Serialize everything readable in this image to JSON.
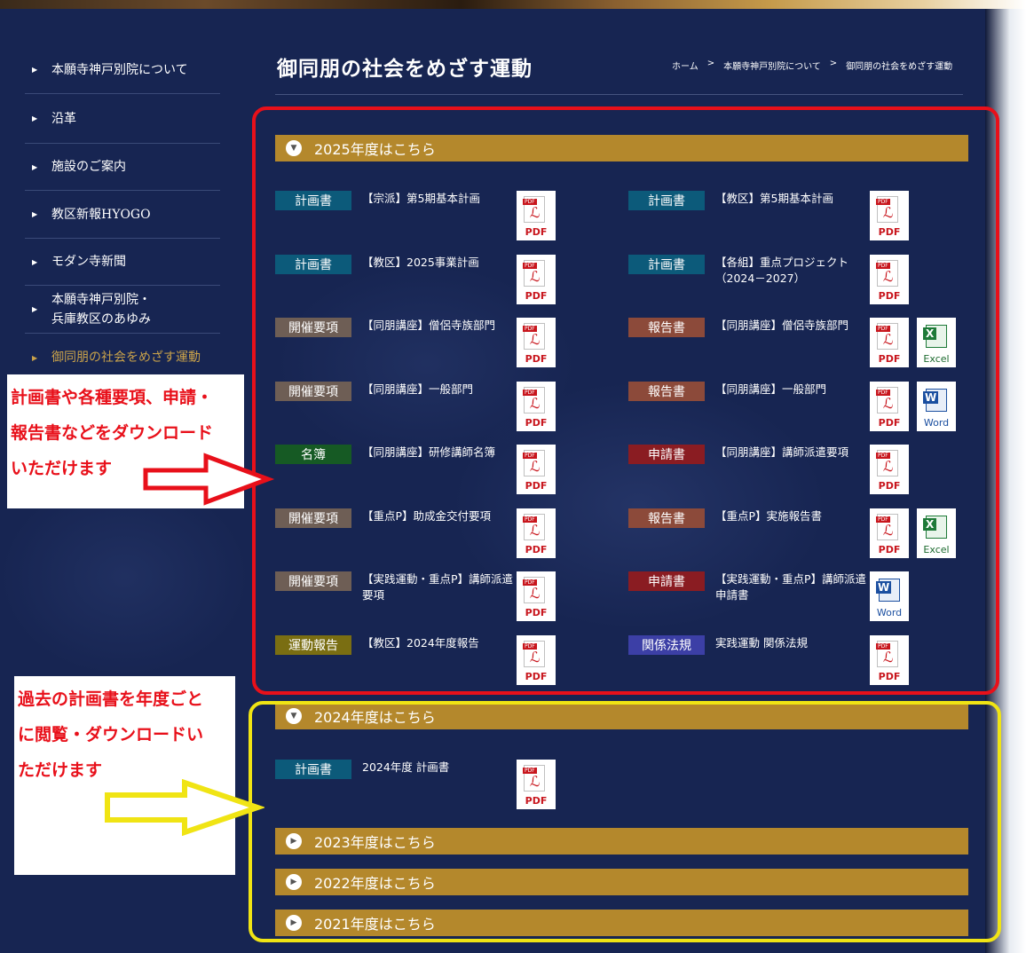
{
  "page_title": "御同朋の社会をめざす運動",
  "breadcrumb": [
    "ホーム",
    ">",
    "本願寺神戸別院について",
    ">",
    "御同朋の社会をめざす運動"
  ],
  "sidebar": {
    "items": [
      {
        "label": "本願寺神戸別院について"
      },
      {
        "label": "沿革"
      },
      {
        "label": "施設のご案内"
      },
      {
        "label": "教区新報HYOGO"
      },
      {
        "label": "モダン寺新聞"
      },
      {
        "label": "本願寺神戸別院・"
      },
      {
        "label": "兵庫教区のあゆみ"
      },
      {
        "label": "御同朋の社会をめざす運動"
      }
    ]
  },
  "years": [
    {
      "label": "2025年度はこちら",
      "expanded": true
    },
    {
      "label": "2024年度はこちら",
      "expanded": true
    },
    {
      "label": "2023年度はこちら",
      "expanded": false
    },
    {
      "label": "2022年度はこちら",
      "expanded": false
    },
    {
      "label": "2021年度はこちら",
      "expanded": false
    }
  ],
  "file_labels": {
    "pdf": "PDF",
    "excel": "Excel",
    "word": "Word"
  },
  "docs_2025": [
    {
      "badge": "計画書",
      "title": "【宗派】第5期基本計画"
    },
    {
      "badge": "計画書",
      "title": "【教区】第5期基本計画"
    },
    {
      "badge": "計画書",
      "title": "【教区】2025事業計画"
    },
    {
      "badge": "計画書",
      "title": "【各組】重点プロジェクト（2024－2027）"
    },
    {
      "badge": "開催要項",
      "title": "【同朋講座】僧侶寺族部門"
    },
    {
      "badge": "報告書",
      "title": "【同朋講座】僧侶寺族部門"
    },
    {
      "badge": "開催要項",
      "title": "【同朋講座】一般部門"
    },
    {
      "badge": "報告書",
      "title": "【同朋講座】一般部門"
    },
    {
      "badge": "名簿",
      "title": "【同朋講座】研修講師名簿"
    },
    {
      "badge": "申請書",
      "title": "【同朋講座】講師派遣要項"
    },
    {
      "badge": "開催要項",
      "title": "【重点P】助成金交付要項"
    },
    {
      "badge": "報告書",
      "title": "【重点P】実施報告書"
    },
    {
      "badge": "開催要項",
      "title": "【実践運動・重点P】講師派遣要項"
    },
    {
      "badge": "申請書",
      "title": "【実践運動・重点P】講師派遣申請書"
    },
    {
      "badge": "運動報告",
      "title": "【教区】2024年度報告"
    },
    {
      "badge": "関係法規",
      "title": "実践運動 関係法規"
    }
  ],
  "docs_2024": [
    {
      "badge": "計画書",
      "title": "2024年度 計画書"
    }
  ],
  "annotations": {
    "note1": [
      "計画書や各種要項、申請・",
      "報告書などをダウンロード",
      "いただけます"
    ],
    "note2": [
      "過去の計画書を年度ごと",
      "に閲覧・ダウンロードい",
      "ただけます"
    ]
  },
  "colors": {
    "navy": "#172552",
    "gold_bar": "#b4882c",
    "red_frame": "#e8101a",
    "yellow_frame": "#f0e414"
  }
}
